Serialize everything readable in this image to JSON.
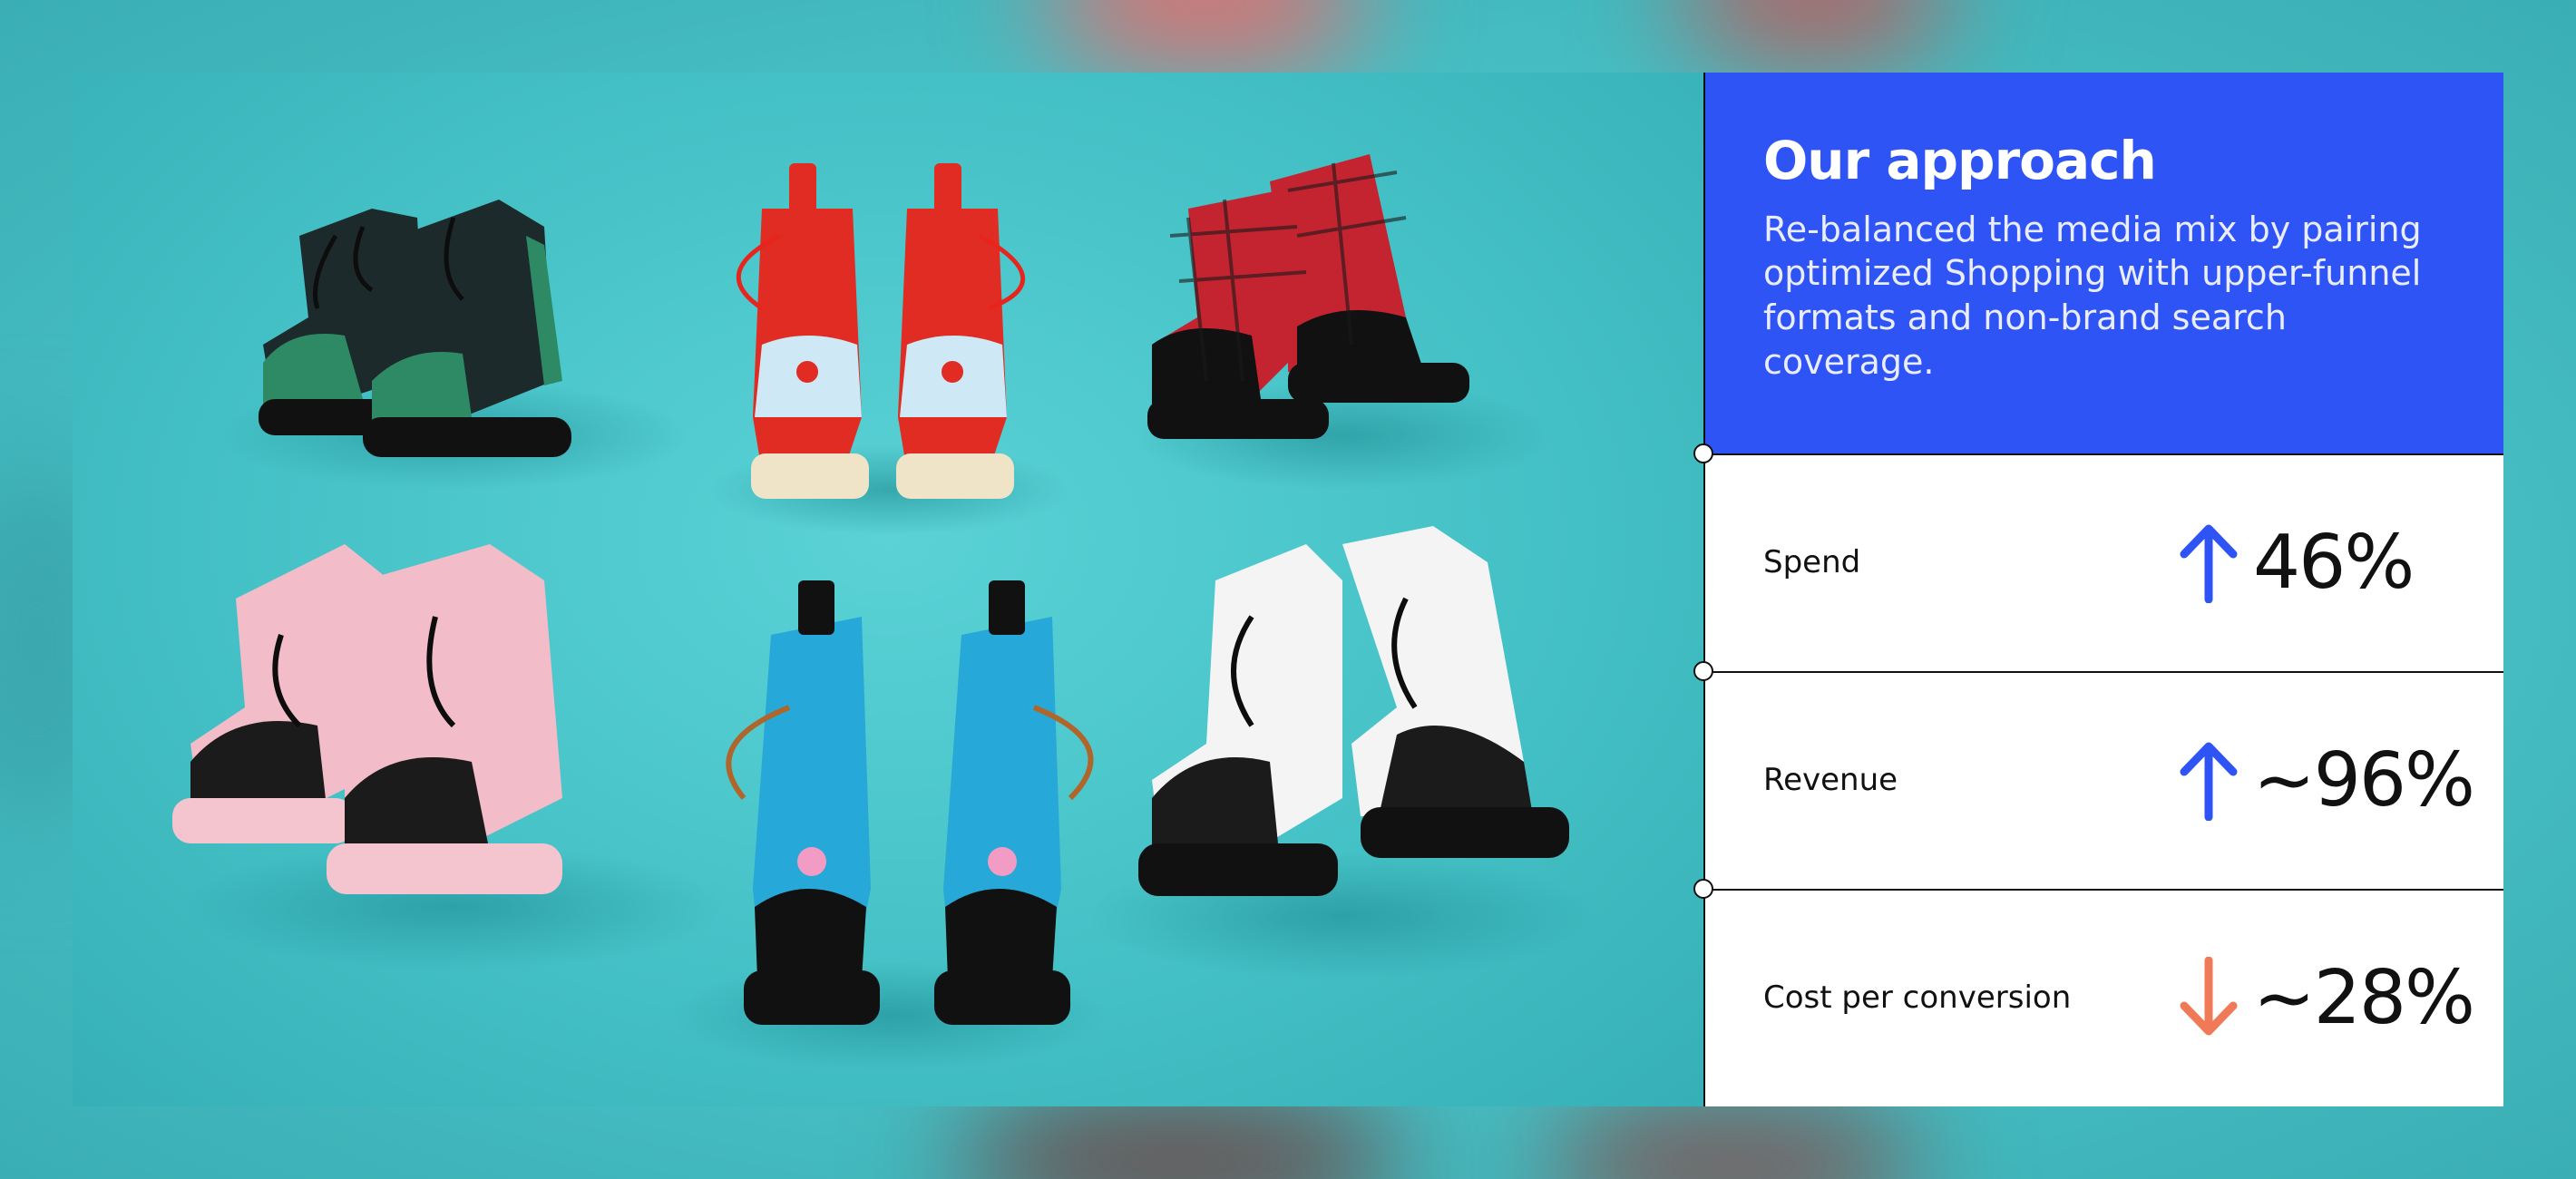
{
  "headline": {
    "title": "Our approach",
    "body": "Re-balanced the media mix by pairing optimized Shopping with upper-funnel formats and non-brand search coverage."
  },
  "metrics": [
    {
      "label": "Spend",
      "value": "46%",
      "direction": "up",
      "arrow_icon": "arrow-up-icon",
      "color": "#2f54f5"
    },
    {
      "label": "Revenue",
      "value": "~96%",
      "direction": "up",
      "arrow_icon": "arrow-up-icon",
      "color": "#2f54f5"
    },
    {
      "label": "Cost per conversion",
      "value": "~28%",
      "direction": "down",
      "arrow_icon": "arrow-down-icon",
      "color": "#f07a57"
    }
  ],
  "colors": {
    "accent": "#2f54f5",
    "negative": "#f07a57",
    "photo_background": "#4cc8cd"
  },
  "photo": {
    "subject": "six pairs of platform lace-up boots"
  }
}
